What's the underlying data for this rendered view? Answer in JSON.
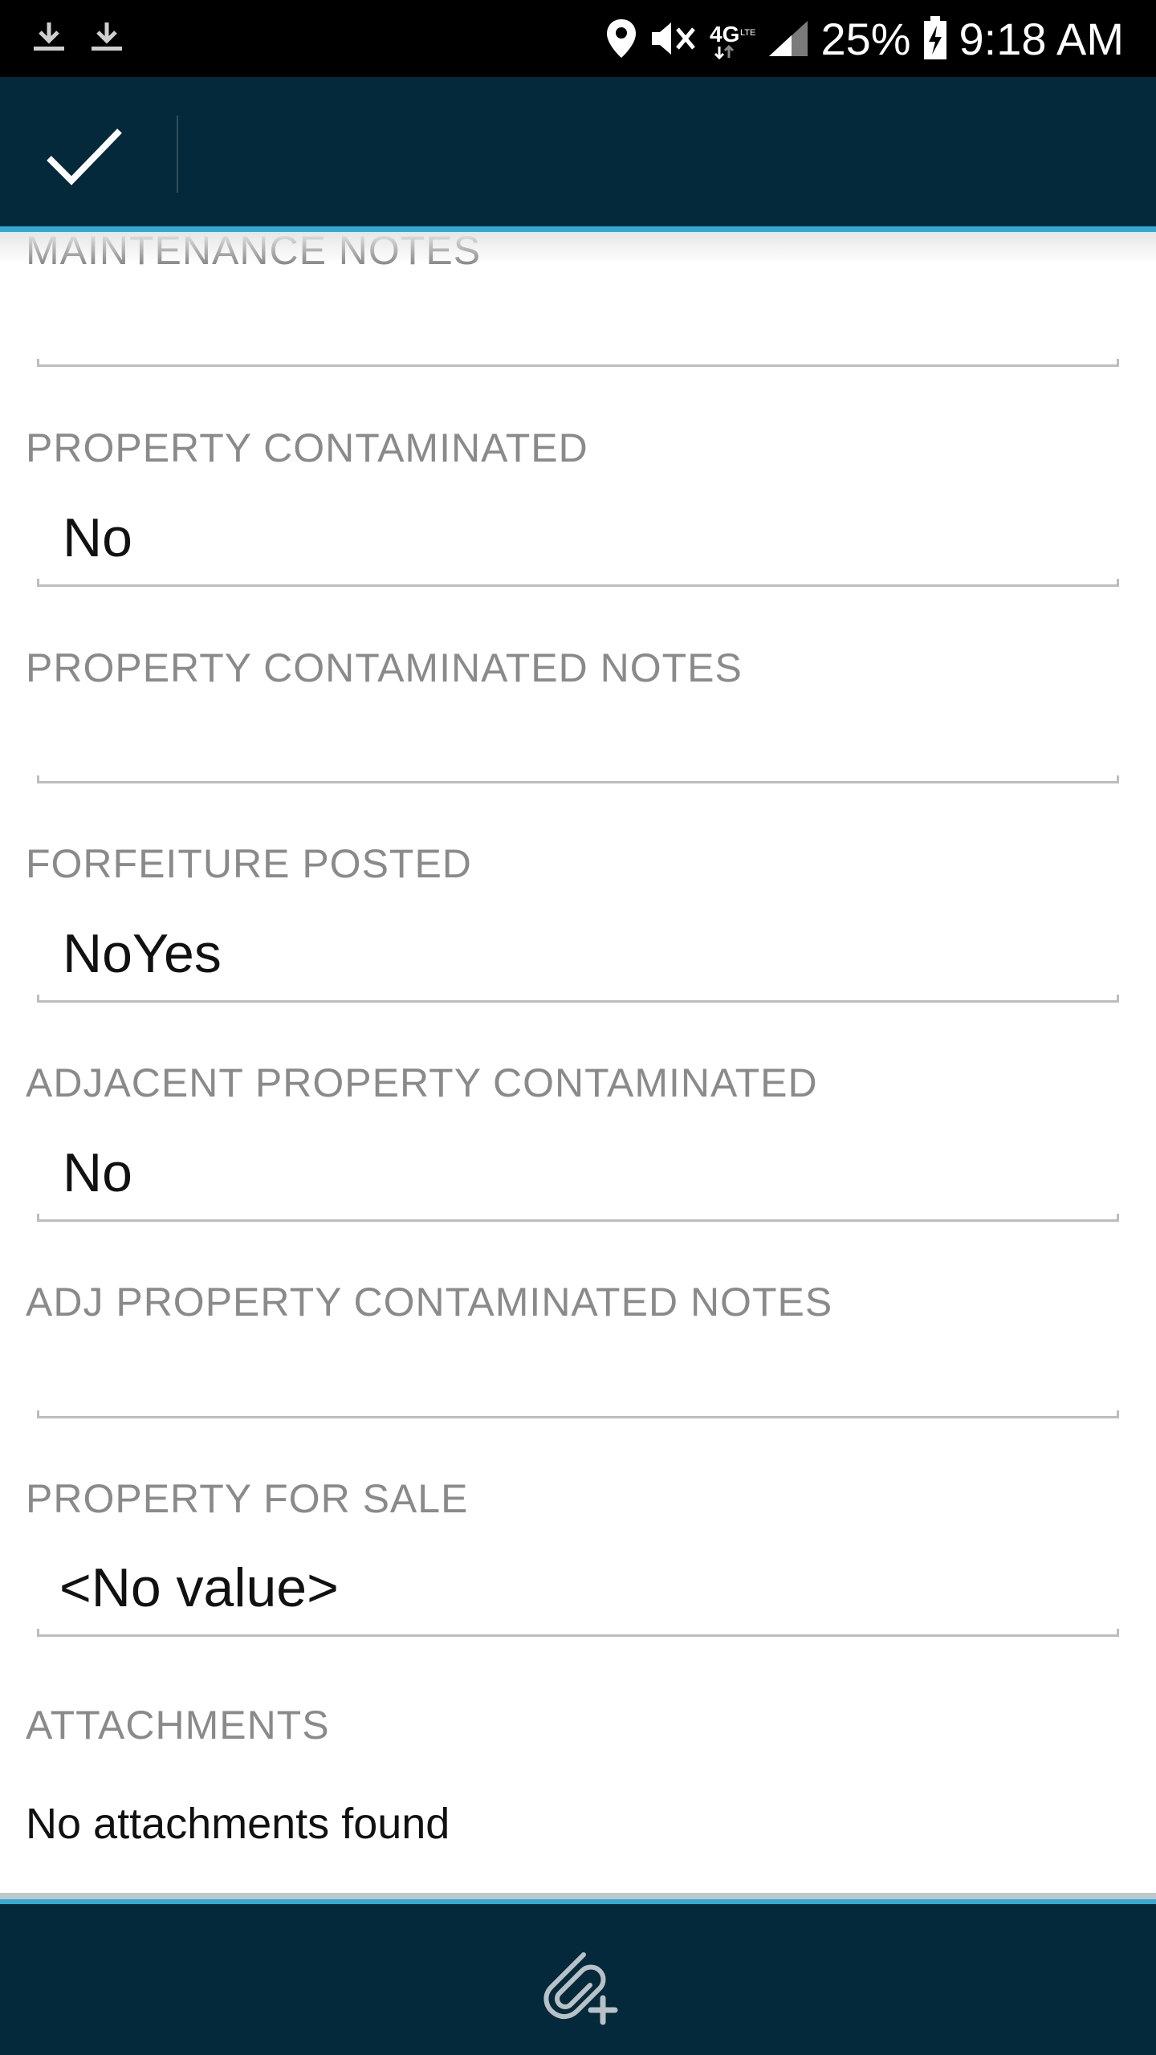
{
  "status_bar": {
    "network": "4G LTE",
    "battery": "25%",
    "time": "9:18 AM",
    "icons": [
      "download-icon",
      "download-icon",
      "location-icon",
      "vibrate-mute-icon",
      "signal-icon",
      "battery-charging-icon"
    ]
  },
  "action_bar": {
    "confirm_icon": "checkmark-icon"
  },
  "form": {
    "maintenance_notes": {
      "label": "MAINTENANCE NOTES",
      "value": ""
    },
    "property_contaminated": {
      "label": "PROPERTY CONTAMINATED",
      "value": "No"
    },
    "property_contaminated_notes": {
      "label": "PROPERTY CONTAMINATED NOTES",
      "value": ""
    },
    "forfeiture_posted": {
      "label": "FORFEITURE POSTED",
      "value": "NoYes"
    },
    "adjacent_property_contaminated": {
      "label": "ADJACENT PROPERTY CONTAMINATED",
      "value": "No"
    },
    "adj_property_contaminated_notes": {
      "label": "ADJ PROPERTY CONTAMINATED NOTES",
      "value": ""
    },
    "property_for_sale": {
      "label": "PROPERTY FOR SALE",
      "value": "<No value>"
    },
    "attachments": {
      "label": "ATTACHMENTS",
      "empty_text": "No attachments found"
    }
  },
  "bottom_bar": {
    "attach_icon": "paperclip-add-icon"
  },
  "colors": {
    "bar_background": "#03293a",
    "accent": "#35a9d6",
    "label_grey": "#8a8a8a"
  }
}
